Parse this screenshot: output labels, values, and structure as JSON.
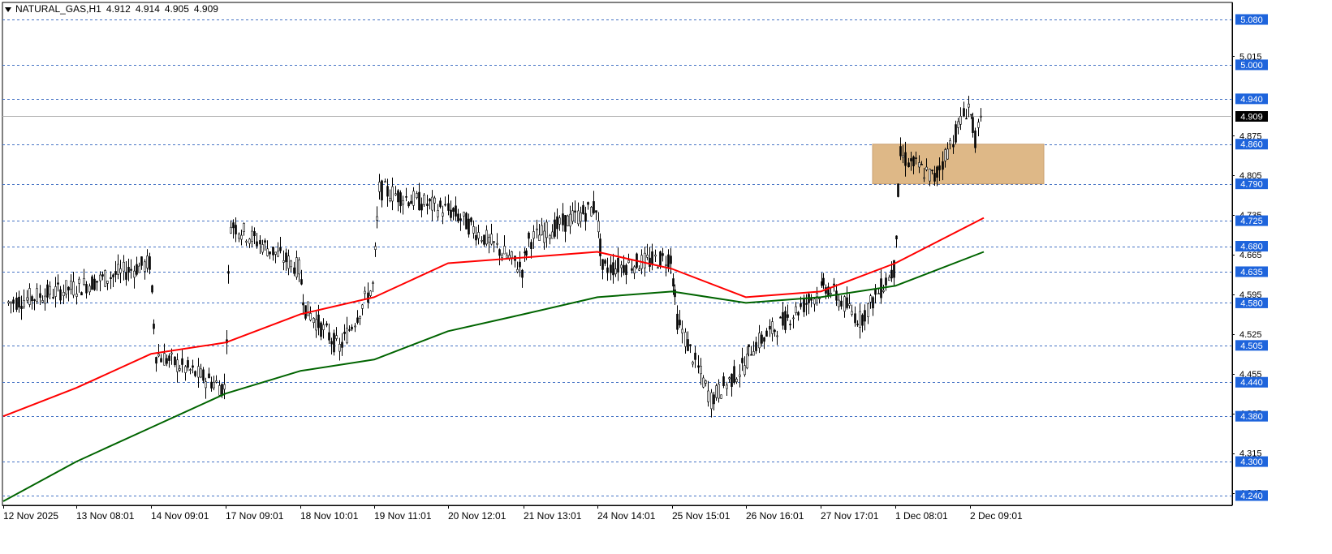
{
  "symbol_header": {
    "symbol": "NATURAL_GAS,H1",
    "open": "4.912",
    "high": "4.914",
    "low": "4.905",
    "close": "4.909"
  },
  "chart_data": {
    "type": "candlestick",
    "title": "",
    "xlabel": "",
    "ylabel": "",
    "ylim": [
      4.21,
      5.1
    ],
    "grid": false,
    "x_tick_labels": [
      "12 Nov 2025",
      "13 Nov 08:01",
      "14 Nov 09:01",
      "17 Nov 09:01",
      "18 Nov 10:01",
      "19 Nov 11:01",
      "20 Nov 12:01",
      "21 Nov 13:01",
      "24 Nov 14:01",
      "25 Nov 15:01",
      "26 Nov 16:01",
      "27 Nov 17:01",
      "1 Dec 08:01",
      "2 Dec 09:01"
    ],
    "y_tick_labels": [
      "5.015",
      "4.875",
      "4.805",
      "4.735",
      "4.665",
      "4.595",
      "4.525",
      "4.455",
      "4.385",
      "4.315",
      "4.245"
    ],
    "horizontal_levels": [
      5.08,
      5.0,
      4.94,
      4.86,
      4.79,
      4.725,
      4.68,
      4.635,
      4.58,
      4.505,
      4.44,
      4.38,
      4.3,
      4.24
    ],
    "current_price": 4.909,
    "zone": {
      "from_date": "27 Nov 17:01",
      "to_date": "2 Dec 09:01",
      "low": 4.79,
      "high": 4.86
    },
    "close_path": [
      {
        "date": "12 Nov 2025",
        "price": 4.58
      },
      {
        "date": "13 Nov 08:01",
        "price": 4.61
      },
      {
        "date": "13 Nov 08:01",
        "price": 4.65
      },
      {
        "date": "14 Nov 09:01",
        "price": 4.49
      },
      {
        "date": "14 Nov 09:01",
        "price": 4.43
      },
      {
        "date": "17 Nov 09:01",
        "price": 4.72
      },
      {
        "date": "17 Nov 09:01",
        "price": 4.64
      },
      {
        "date": "18 Nov 10:01",
        "price": 4.57
      },
      {
        "date": "18 Nov 10:01",
        "price": 4.5
      },
      {
        "date": "18 Nov 10:01",
        "price": 4.61
      },
      {
        "date": "19 Nov 11:01",
        "price": 4.78
      },
      {
        "date": "20 Nov 12:01",
        "price": 4.74
      },
      {
        "date": "20 Nov 12:01",
        "price": 4.64
      },
      {
        "date": "21 Nov 13:01",
        "price": 4.69
      },
      {
        "date": "21 Nov 13:01",
        "price": 4.75
      },
      {
        "date": "24 Nov 14:01",
        "price": 4.64
      },
      {
        "date": "24 Nov 14:01",
        "price": 4.66
      },
      {
        "date": "25 Nov 15:01",
        "price": 4.55
      },
      {
        "date": "25 Nov 15:01",
        "price": 4.41
      },
      {
        "date": "25 Nov 15:01",
        "price": 4.47
      },
      {
        "date": "26 Nov 16:01",
        "price": 4.5
      },
      {
        "date": "26 Nov 16:01",
        "price": 4.6
      },
      {
        "date": "27 Nov 17:01",
        "price": 4.61
      },
      {
        "date": "27 Nov 17:01",
        "price": 4.55
      },
      {
        "date": "27 Nov 17:01",
        "price": 4.64
      },
      {
        "date": "1 Dec 08:01",
        "price": 4.84
      },
      {
        "date": "1 Dec 08:01",
        "price": 4.8
      },
      {
        "date": "1 Dec 08:01",
        "price": 4.93
      },
      {
        "date": "2 Dec 09:01",
        "price": 4.87
      },
      {
        "date": "2 Dec 09:01",
        "price": 4.909
      }
    ],
    "series": [
      {
        "color": "#ff0000",
        "points": [
          {
            "date": "12 Nov 2025",
            "value": 4.38
          },
          {
            "date": "13 Nov 08:01",
            "value": 4.43
          },
          {
            "date": "14 Nov 09:01",
            "value": 4.49
          },
          {
            "date": "17 Nov 09:01",
            "value": 4.51
          },
          {
            "date": "18 Nov 10:01",
            "value": 4.56
          },
          {
            "date": "19 Nov 11:01",
            "value": 4.59
          },
          {
            "date": "20 Nov 12:01",
            "value": 4.65
          },
          {
            "date": "21 Nov 13:01",
            "value": 4.66
          },
          {
            "date": "24 Nov 14:01",
            "value": 4.67
          },
          {
            "date": "25 Nov 15:01",
            "value": 4.64
          },
          {
            "date": "26 Nov 16:01",
            "value": 4.59
          },
          {
            "date": "27 Nov 17:01",
            "value": 4.6
          },
          {
            "date": "1 Dec 08:01",
            "value": 4.65
          },
          {
            "date": "2 Dec 09:01",
            "value": 4.73
          }
        ]
      },
      {
        "color": "#006400",
        "points": [
          {
            "date": "12 Nov 2025",
            "value": 4.23
          },
          {
            "date": "13 Nov 08:01",
            "value": 4.3
          },
          {
            "date": "14 Nov 09:01",
            "value": 4.36
          },
          {
            "date": "17 Nov 09:01",
            "value": 4.42
          },
          {
            "date": "18 Nov 10:01",
            "value": 4.46
          },
          {
            "date": "19 Nov 11:01",
            "value": 4.48
          },
          {
            "date": "20 Nov 12:01",
            "value": 4.53
          },
          {
            "date": "21 Nov 13:01",
            "value": 4.56
          },
          {
            "date": "24 Nov 14:01",
            "value": 4.59
          },
          {
            "date": "25 Nov 15:01",
            "value": 4.6
          },
          {
            "date": "26 Nov 16:01",
            "value": 4.58
          },
          {
            "date": "27 Nov 17:01",
            "value": 4.59
          },
          {
            "date": "1 Dec 08:01",
            "value": 4.61
          },
          {
            "date": "2 Dec 09:01",
            "value": 4.67
          }
        ]
      }
    ],
    "colors": {
      "candle": "#000000",
      "level_line": "#4472c4",
      "level_label_bg": "#1e64dc",
      "current_label_bg": "#000000",
      "zone_fill": "#deb887",
      "axis": "#000000"
    }
  }
}
